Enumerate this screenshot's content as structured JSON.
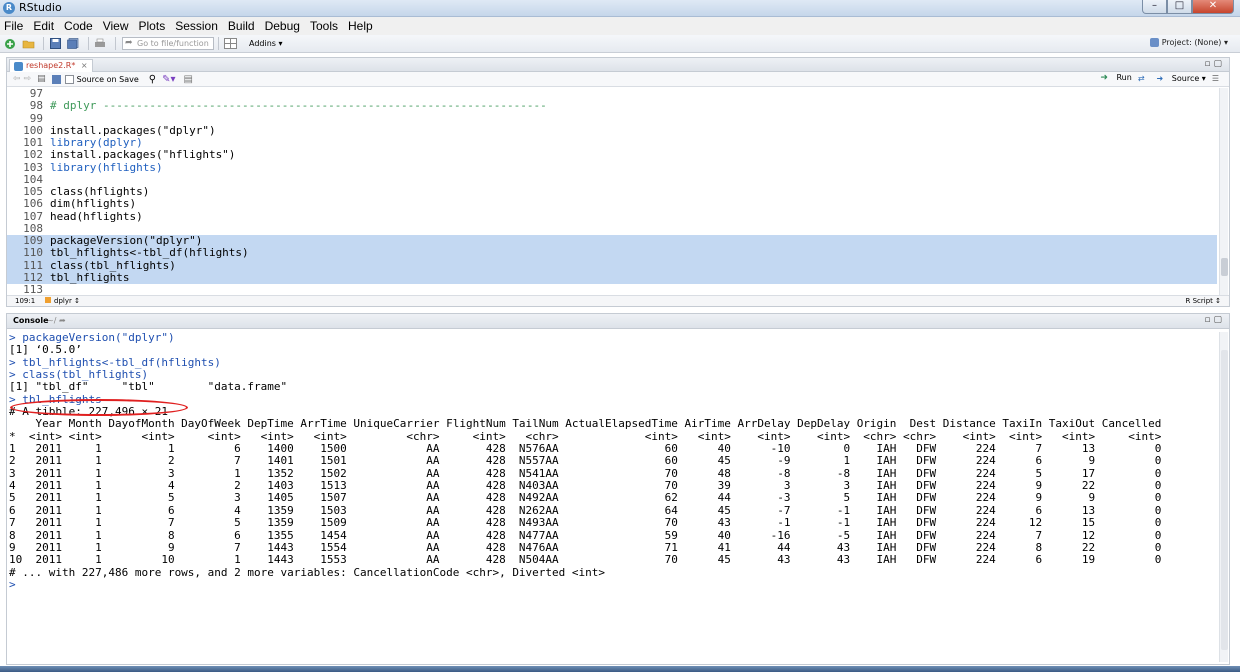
{
  "window": {
    "title": "RStudio"
  },
  "menu": [
    "File",
    "Edit",
    "Code",
    "View",
    "Plots",
    "Session",
    "Build",
    "Debug",
    "Tools",
    "Help"
  ],
  "toolbar": {
    "goto_placeholder": "Go to file/function",
    "addins": "Addins",
    "project": "Project: (None)"
  },
  "editor": {
    "tab_name": "reshape2.R*",
    "source_on_save": "Source on Save",
    "run_label": "Run",
    "source_label": "Source",
    "lines": [
      {
        "n": "97",
        "text": "",
        "sel": false,
        "kind": "plain"
      },
      {
        "n": "98",
        "text": "# dplyr -------------------------------------------------------------------",
        "sel": false,
        "kind": "comment"
      },
      {
        "n": "99",
        "text": "",
        "sel": false,
        "kind": "plain"
      },
      {
        "n": "100",
        "text": "install.packages(\"dplyr\")",
        "sel": false,
        "kind": "plain"
      },
      {
        "n": "101",
        "text": "library(dplyr)",
        "sel": false,
        "kind": "fn"
      },
      {
        "n": "102",
        "text": "install.packages(\"hflights\")",
        "sel": false,
        "kind": "plain"
      },
      {
        "n": "103",
        "text": "library(hflights)",
        "sel": false,
        "kind": "fn"
      },
      {
        "n": "104",
        "text": "",
        "sel": false,
        "kind": "plain"
      },
      {
        "n": "105",
        "text": "class(hflights)",
        "sel": false,
        "kind": "plain"
      },
      {
        "n": "106",
        "text": "dim(hflights)",
        "sel": false,
        "kind": "plain"
      },
      {
        "n": "107",
        "text": "head(hflights)",
        "sel": false,
        "kind": "plain"
      },
      {
        "n": "108",
        "text": "",
        "sel": false,
        "kind": "plain"
      },
      {
        "n": "109",
        "text": "packageVersion(\"dplyr\")",
        "sel": true,
        "kind": "plain"
      },
      {
        "n": "110",
        "text": "tbl_hflights<-tbl_df(hflights)",
        "sel": true,
        "kind": "plain"
      },
      {
        "n": "111",
        "text": "class(tbl_hflights)",
        "sel": true,
        "kind": "plain"
      },
      {
        "n": "112",
        "text": "tbl_hflights",
        "sel": true,
        "kind": "plain"
      },
      {
        "n": "113",
        "text": "",
        "sel": false,
        "kind": "plain"
      }
    ],
    "status_pos": "109:1",
    "status_scope": "dplyr",
    "status_type": "R Script"
  },
  "console": {
    "label": "Console",
    "path": "~/",
    "lines": [
      {
        "text": "> packageVersion(\"dplyr\")",
        "kind": "cmd"
      },
      {
        "text": "[1] ‘0.5.0’",
        "kind": "out"
      },
      {
        "text": "> tbl_hflights<-tbl_df(hflights)",
        "kind": "cmd"
      },
      {
        "text": "> class(tbl_hflights)",
        "kind": "cmd"
      },
      {
        "text": "[1] \"tbl_df\"     \"tbl\"        \"data.frame\"",
        "kind": "out"
      },
      {
        "text": "> tbl_hflights",
        "kind": "cmd"
      },
      {
        "text": "# A tibble: 227,496 × 21",
        "kind": "out"
      },
      {
        "text": "    Year Month DayofMonth DayOfWeek DepTime ArrTime UniqueCarrier FlightNum TailNum ActualElapsedTime AirTime ArrDelay DepDelay Origin  Dest Distance TaxiIn TaxiOut Cancelled",
        "kind": "out"
      },
      {
        "text": "*  <int> <int>      <int>     <int>   <int>   <int>         <chr>     <int>   <chr>             <int>   <int>    <int>    <int>  <chr> <chr>    <int>  <int>   <int>     <int>",
        "kind": "out"
      },
      {
        "text": "1   2011     1          1         6    1400    1500            AA       428  N576AA                60      40      -10        0    IAH   DFW      224      7      13         0",
        "kind": "out"
      },
      {
        "text": "2   2011     1          2         7    1401    1501            AA       428  N557AA                60      45       -9        1    IAH   DFW      224      6       9         0",
        "kind": "out"
      },
      {
        "text": "3   2011     1          3         1    1352    1502            AA       428  N541AA                70      48       -8       -8    IAH   DFW      224      5      17         0",
        "kind": "out"
      },
      {
        "text": "4   2011     1          4         2    1403    1513            AA       428  N403AA                70      39        3        3    IAH   DFW      224      9      22         0",
        "kind": "out"
      },
      {
        "text": "5   2011     1          5         3    1405    1507            AA       428  N492AA                62      44       -3        5    IAH   DFW      224      9       9         0",
        "kind": "out"
      },
      {
        "text": "6   2011     1          6         4    1359    1503            AA       428  N262AA                64      45       -7       -1    IAH   DFW      224      6      13         0",
        "kind": "out"
      },
      {
        "text": "7   2011     1          7         5    1359    1509            AA       428  N493AA                70      43       -1       -1    IAH   DFW      224     12      15         0",
        "kind": "out"
      },
      {
        "text": "8   2011     1          8         6    1355    1454            AA       428  N477AA                59      40      -16       -5    IAH   DFW      224      7      12         0",
        "kind": "out"
      },
      {
        "text": "9   2011     1          9         7    1443    1554            AA       428  N476AA                71      41       44       43    IAH   DFW      224      8      22         0",
        "kind": "out"
      },
      {
        "text": "10  2011     1         10         1    1443    1553            AA       428  N504AA                70      45       43       43    IAH   DFW      224      6      19         0",
        "kind": "out"
      },
      {
        "text": "# ... with 227,486 more rows, and 2 more variables: CancellationCode <chr>, Diverted <int>",
        "kind": "out"
      },
      {
        "text": ">",
        "kind": "cmd"
      }
    ]
  }
}
